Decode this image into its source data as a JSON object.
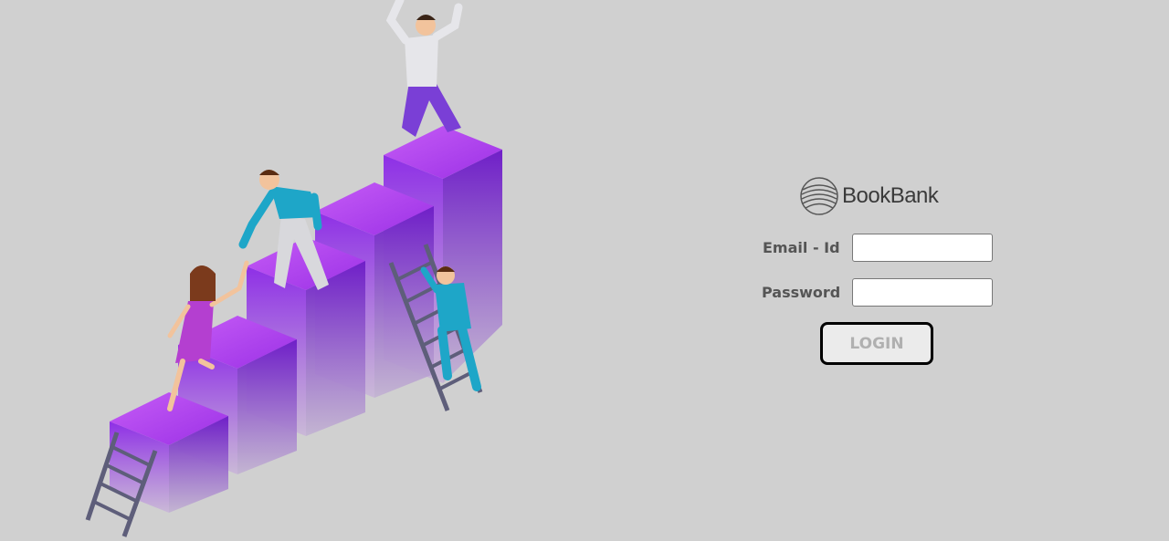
{
  "brand": {
    "name": "BookBank",
    "logo_icon": "globe-lines-icon"
  },
  "form": {
    "email_label": "Email - Id",
    "email_value": "",
    "password_label": "Password",
    "password_value": "",
    "login_label": "LOGIN"
  },
  "illustration": {
    "subject": "people-climbing-purple-steps",
    "colors": {
      "block": "#8b2fe0",
      "shirt_teal": "#1ea6c8",
      "ladder": "#6a6a86",
      "skin": "#f2c39c"
    }
  }
}
